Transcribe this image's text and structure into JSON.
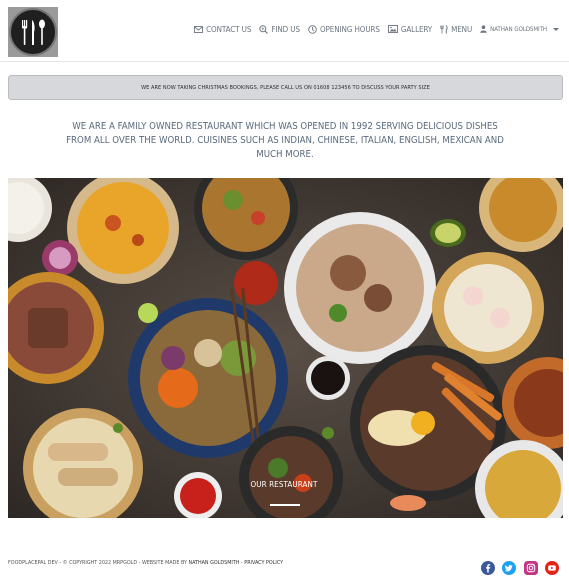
{
  "nav": {
    "items": [
      {
        "label": "Contact Us",
        "icon": "envelope-icon"
      },
      {
        "label": "Find Us",
        "icon": "search-icon"
      },
      {
        "label": "Opening Hours",
        "icon": "clock-icon"
      },
      {
        "label": "Gallery",
        "icon": "image-icon"
      },
      {
        "label": "Menu",
        "icon": "utensils-icon"
      }
    ],
    "user": {
      "label": "Nathan Goldsmith",
      "icon": "user-icon"
    }
  },
  "banner": {
    "text": "We are now taking Christmas bookings, please call us on 01608 123456 to discuss your party size"
  },
  "intro": {
    "text": "We are a family owned restaurant which was opened in 1992 serving delicious dishes from all over the world. Cuisines such as Indian, Chinese, Italian, English, Mexican and much more."
  },
  "hero": {
    "caption": "Our Restaurant"
  },
  "footer": {
    "brand": "FoodPlacePal Dev",
    "copyright": " - © Copyright 2022 MrPGold - Website made by ",
    "author": "Nathan Goldsmith",
    "sep": " - ",
    "privacy": "Privacy Policy"
  },
  "social": [
    {
      "name": "facebook",
      "color": "#3b5998"
    },
    {
      "name": "twitter",
      "color": "#1da1f2"
    },
    {
      "name": "instagram",
      "color": "#c13584"
    },
    {
      "name": "youtube",
      "color": "#e62117"
    }
  ]
}
